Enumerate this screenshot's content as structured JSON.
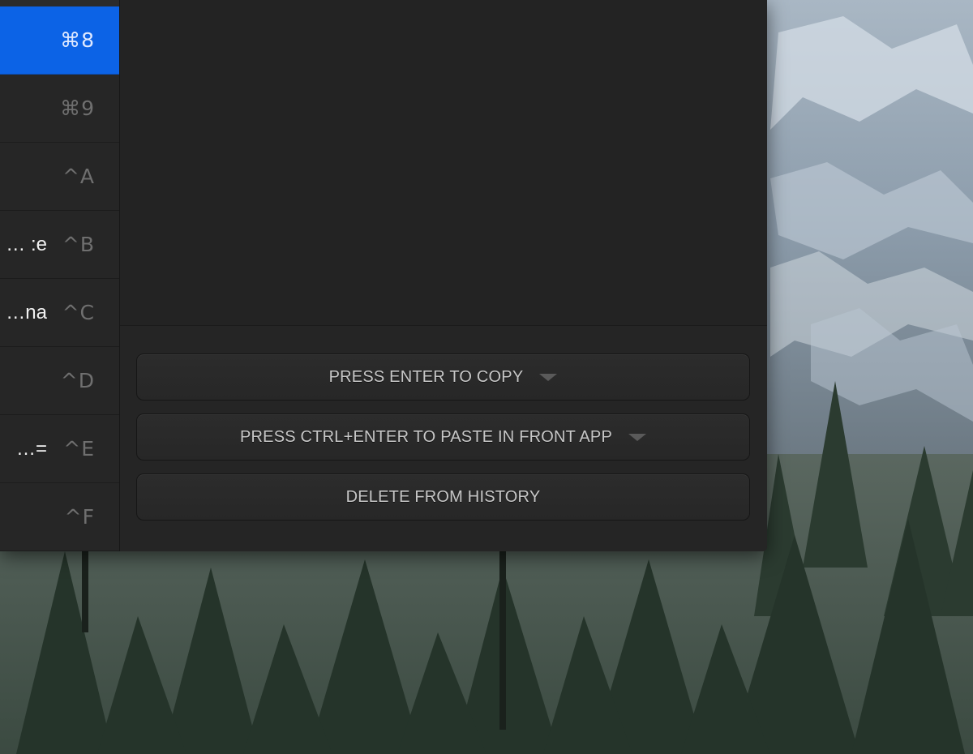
{
  "history": {
    "items": [
      {
        "preview": "",
        "shortcut": "⌘8",
        "selected": true
      },
      {
        "preview": "",
        "shortcut": "⌘9",
        "selected": false
      },
      {
        "preview": "",
        "shortcut": "^A",
        "selected": false
      },
      {
        "preview": "e: …",
        "shortcut": "^B",
        "selected": false
      },
      {
        "preview": "na…",
        "shortcut": "^C",
        "selected": false
      },
      {
        "preview": "",
        "shortcut": "^D",
        "selected": false
      },
      {
        "preview": "=…",
        "shortcut": "^E",
        "selected": false
      },
      {
        "preview": "",
        "shortcut": "^F",
        "selected": false
      }
    ]
  },
  "actions": {
    "copy_label": "PRESS ENTER TO COPY",
    "paste_label": "PRESS CTRL+ENTER TO PASTE IN FRONT APP",
    "delete_label": "DELETE FROM HISTORY",
    "copy_icon": "chevron-down-icon",
    "paste_icon": "chevron-down-icon"
  },
  "colors": {
    "selection": "#0c63e6",
    "window_bg": "#232323",
    "button_text": "#c7c7c7"
  }
}
